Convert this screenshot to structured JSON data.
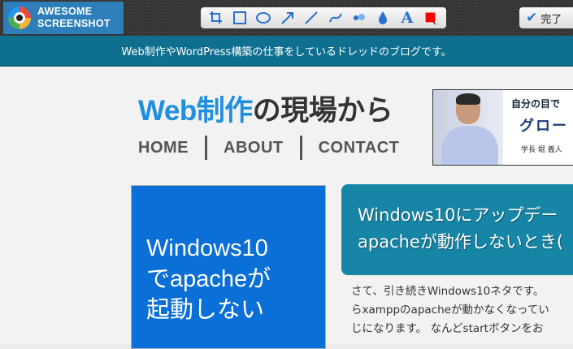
{
  "toolbar": {
    "brand_line1": "AWESOME",
    "brand_line2": "SCREENSHOT",
    "tools": [
      {
        "name": "crop-icon"
      },
      {
        "name": "rectangle-icon"
      },
      {
        "name": "ellipse-icon"
      },
      {
        "name": "arrow-icon"
      },
      {
        "name": "line-icon"
      },
      {
        "name": "curve-icon"
      },
      {
        "name": "blur-icon"
      },
      {
        "name": "drop-icon"
      },
      {
        "name": "text-icon",
        "glyph": "A"
      },
      {
        "name": "color-icon",
        "color": "#ff0000"
      }
    ],
    "done_label": "完了",
    "accent": "#2a6fd1"
  },
  "banner": {
    "text": "Web制作やWordPress構築の仕事をしているドレッドのブログです。"
  },
  "site": {
    "title_part1": "Web制作",
    "title_part2": "の現場から",
    "nav": [
      "HOME",
      "ABOUT",
      "CONTACT"
    ]
  },
  "ad": {
    "line1": "自分の目で",
    "line2": "グロー",
    "line3": "学長 堀 義人"
  },
  "thumbnail": {
    "lines": [
      "Windows10",
      "でapacheが",
      "起動しない"
    ]
  },
  "post": {
    "title_lines": [
      "Windows10にアップデー",
      "apacheが動作しないとき("
    ],
    "excerpt_lines": [
      "さて、引き続きWindows10ネタです。",
      "らxamppのapacheが動かなくなってい",
      "じになります。 なんどstartボタンをお"
    ]
  }
}
